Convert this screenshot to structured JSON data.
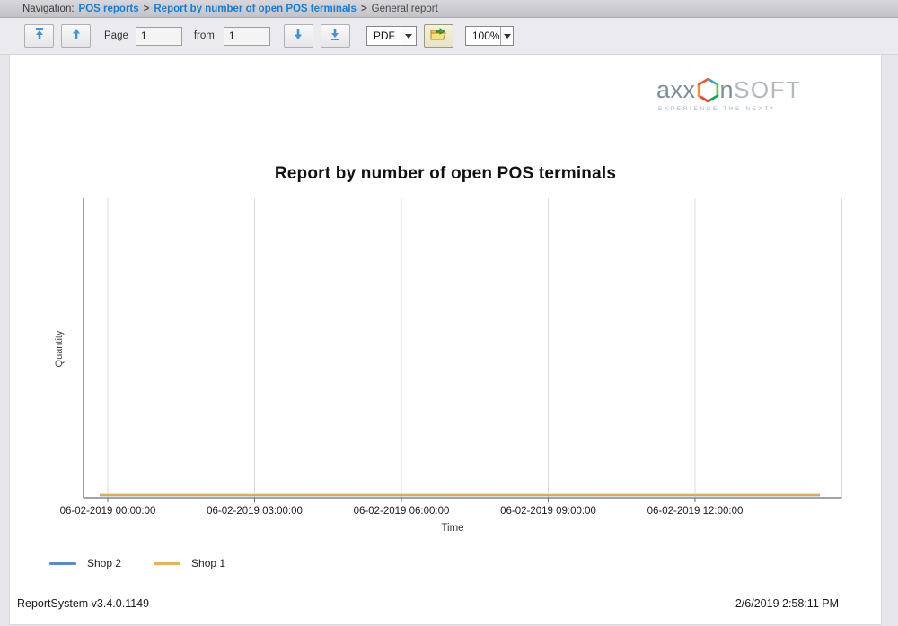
{
  "breadcrumb": {
    "prefix": "Navigation:",
    "separator": ">",
    "items": [
      {
        "label": "POS reports",
        "link": true
      },
      {
        "label": "Report by number of open POS terminals",
        "link": true
      },
      {
        "label": "General report",
        "link": false
      }
    ]
  },
  "toolbar": {
    "page_label": "Page",
    "page_value": "1",
    "from_label": "from",
    "total_value": "1",
    "format_value": "PDF",
    "zoom_value": "100%",
    "icons": {
      "first_page": "arrow-up-to-bar",
      "prev_page": "arrow-up",
      "next_page": "arrow-down",
      "last_page": "arrow-down-to-bar",
      "export": "open-folder-export",
      "format_chevron": "chevron-down",
      "zoom_chevron": "chevron-down"
    }
  },
  "logo": {
    "part1": "axx",
    "part2": "n",
    "part3": "SOFT",
    "tagline": "EXPERIENCE THE NEXT*",
    "hex_colors": [
      "#29abe2",
      "#72bf44",
      "#00a651",
      "#e8412c",
      "#f7941d",
      "#f15a29"
    ]
  },
  "report": {
    "title": "Report by number of open POS terminals"
  },
  "chart_data": {
    "type": "line",
    "title": "Report by number of open POS terminals",
    "xlabel": "Time",
    "ylabel": "Quantity",
    "x_ticks": [
      "06-02-2019 00:00:00",
      "06-02-2019 03:00:00",
      "06-02-2019 06:00:00",
      "06-02-2019 09:00:00",
      "06-02-2019 12:00:00"
    ],
    "x_range": [
      "06-02-2019 00:00:00",
      "06-02-2019 15:00:00"
    ],
    "ylim": [
      0,
      null
    ],
    "grid": "vertical-only",
    "legend_position": "bottom-left",
    "series": [
      {
        "name": "Shop 2",
        "color": "#5b8bc5",
        "points": [
          {
            "x": "06-02-2019 00:00:00",
            "y": 1
          },
          {
            "x": "06-02-2019 14:45:00",
            "y": 1
          }
        ]
      },
      {
        "name": "Shop 1",
        "color": "#e9b156",
        "points": [
          {
            "x": "06-02-2019 00:00:00",
            "y": 1
          },
          {
            "x": "06-02-2019 14:45:00",
            "y": 1
          }
        ]
      }
    ]
  },
  "footer": {
    "left": "ReportSystem v3.4.0.1149",
    "right": "2/6/2019 2:58:11 PM"
  },
  "colors": {
    "link_blue": "#157fd6",
    "arrow_blue": "#3f93d8",
    "axis": "#6e6e6e",
    "gridline": "#dcdcdc"
  }
}
